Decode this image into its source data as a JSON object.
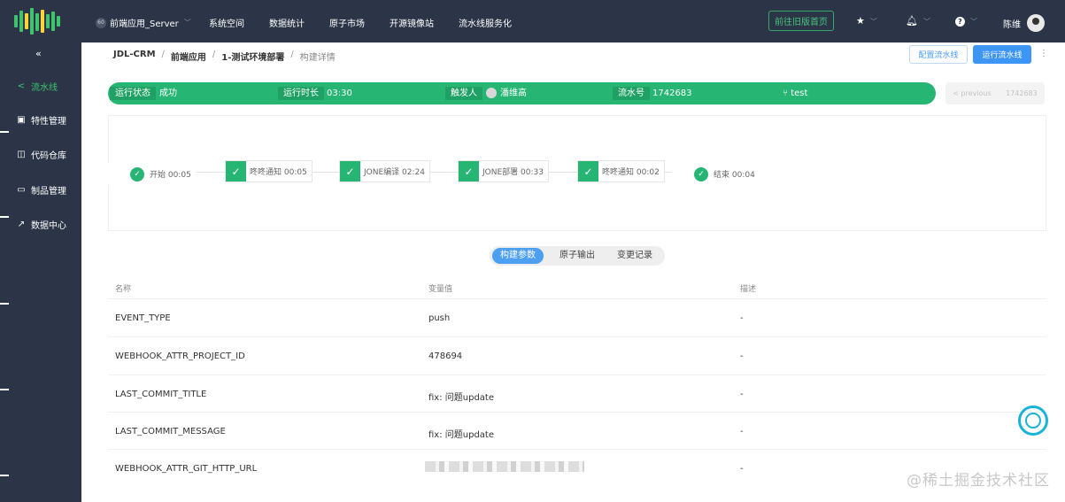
{
  "topbar": {
    "app_switch": "前端应用_Server",
    "app_badge": "60",
    "nav": [
      "系统空间",
      "数据统计",
      "原子市场",
      "开源镜像站",
      "流水线服务化"
    ],
    "old_version_button": "前往旧版首页",
    "user_name": "陈维"
  },
  "sidebar": {
    "collapse_glyph": "«",
    "items": [
      {
        "label": "流水线",
        "icon": "share-icon"
      },
      {
        "label": "特性管理",
        "icon": "clipboard-icon"
      },
      {
        "label": "代码仓库",
        "icon": "repo-icon"
      },
      {
        "label": "制品管理",
        "icon": "box-icon"
      },
      {
        "label": "数据中心",
        "icon": "external-icon"
      }
    ]
  },
  "breadcrumb": [
    "JDL-CRM",
    "前端应用",
    "1-测试环境部署",
    "构建详情"
  ],
  "header_actions": {
    "config": "配置流水线",
    "run": "运行流水线"
  },
  "status": {
    "state_label": "运行状态",
    "state_value": "成功",
    "duration_label": "运行时长",
    "duration_value": "03:30",
    "trigger_label": "触发人",
    "trigger_value": "潘维高",
    "number_label": "流水号",
    "number_value": "1742683",
    "branch": "test"
  },
  "prev_nav": {
    "label": "< previous",
    "number": "1742683"
  },
  "stages": [
    {
      "name": "开始 00:05"
    },
    {
      "name": "咚咚通知 00:05"
    },
    {
      "name": "JONE编译 02:24"
    },
    {
      "name": "JONE部署 00:33"
    },
    {
      "name": "咚咚通知 00:02"
    },
    {
      "name": "结束 00:04"
    }
  ],
  "tabs": [
    "构建参数",
    "原子输出",
    "变更记录"
  ],
  "table": {
    "headers": [
      "名称",
      "变量值",
      "描述"
    ],
    "rows": [
      [
        "EVENT_TYPE",
        "push",
        "-"
      ],
      [
        "WEBHOOK_ATTR_PROJECT_ID",
        "478694",
        "-"
      ],
      [
        "LAST_COMMIT_TITLE",
        "fix: 问题update",
        "-"
      ],
      [
        "LAST_COMMIT_MESSAGE",
        "fix: 问题update",
        "-"
      ],
      [
        "WEBHOOK_ATTR_GIT_HTTP_URL",
        "",
        "-"
      ]
    ]
  },
  "watermark": "@稀土掘金技术社区",
  "colors": {
    "topbar": "#2b3547",
    "success": "#26b573",
    "primary": "#3d96f5"
  }
}
